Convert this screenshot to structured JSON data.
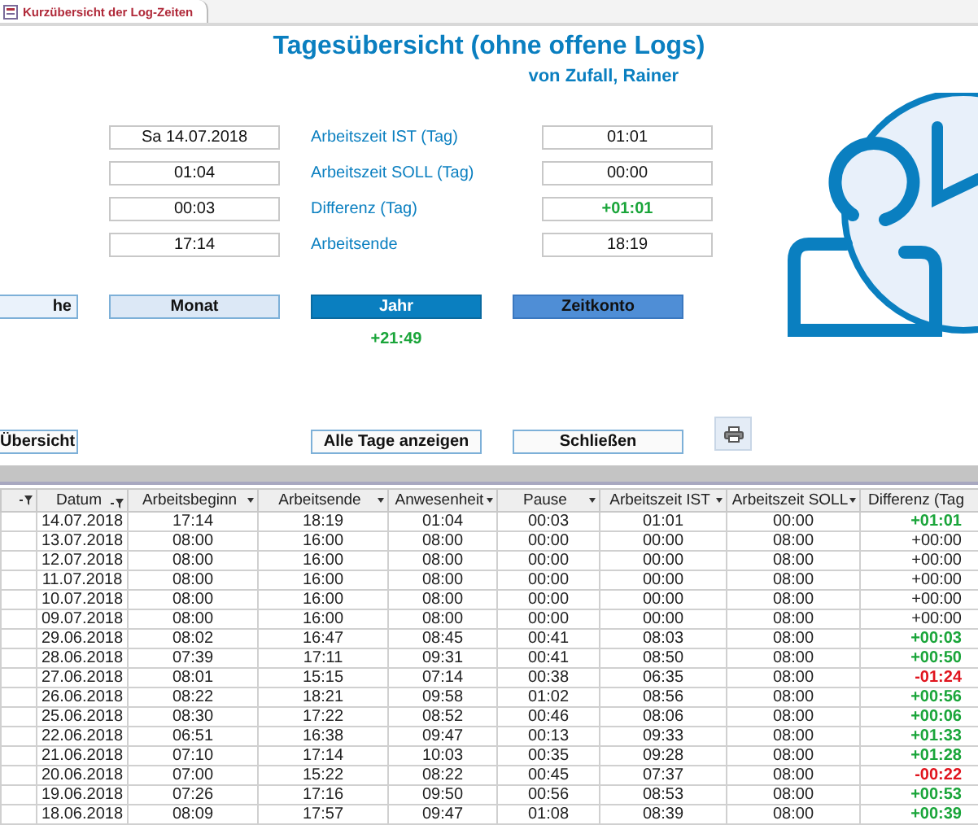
{
  "tab": {
    "title": "Kurzübersicht der Log-Zeiten"
  },
  "title": "Tagesübersicht (ohne offene Logs)",
  "subtitle": "von Zufall, Rainer",
  "fields": [
    {
      "value": "Sa 14.07.2018",
      "label": "Arbeitszeit IST (Tag)",
      "result": "01:01",
      "kind": "plain"
    },
    {
      "value": "01:04",
      "label": "Arbeitszeit SOLL (Tag)",
      "result": "00:00",
      "kind": "plain"
    },
    {
      "value": "00:03",
      "label": "Differenz (Tag)",
      "result": "+01:01",
      "kind": "plus"
    },
    {
      "value": "17:14",
      "label": "Arbeitsende",
      "result": "18:19",
      "kind": "plain"
    }
  ],
  "period_buttons": [
    {
      "label": "he",
      "selected": false
    },
    {
      "label": "Monat",
      "selected": false
    },
    {
      "label": "Jahr",
      "selected": true
    }
  ],
  "account_button": {
    "label": "Zeitkonto"
  },
  "year_balance": "+21:49",
  "actions": [
    {
      "label": "Übersicht"
    },
    {
      "label": "Alle Tage anzeigen"
    },
    {
      "label": "Schließen"
    }
  ],
  "table": {
    "selector_column": {
      "filtered": true
    },
    "columns": [
      {
        "label": "Datum",
        "filtered": true
      },
      {
        "label": "Arbeitsbeginn",
        "filtered": false
      },
      {
        "label": "Arbeitsende",
        "filtered": false
      },
      {
        "label": "Anwesenheit",
        "filtered": false
      },
      {
        "label": "Pause",
        "filtered": false
      },
      {
        "label": "Arbeitszeit IST",
        "filtered": false
      },
      {
        "label": "Arbeitszeit SOLL",
        "filtered": false
      },
      {
        "label": "Differenz (Tag"
      }
    ],
    "rows": [
      {
        "cells": [
          "14.07.2018",
          "17:14",
          "18:19",
          "01:04",
          "00:03",
          "01:01",
          "00:00"
        ],
        "diff": "+01:01",
        "kind": "plus"
      },
      {
        "cells": [
          "13.07.2018",
          "08:00",
          "16:00",
          "08:00",
          "00:00",
          "00:00",
          "08:00"
        ],
        "diff": "+00:00",
        "kind": "zero"
      },
      {
        "cells": [
          "12.07.2018",
          "08:00",
          "16:00",
          "08:00",
          "00:00",
          "00:00",
          "08:00"
        ],
        "diff": "+00:00",
        "kind": "zero"
      },
      {
        "cells": [
          "11.07.2018",
          "08:00",
          "16:00",
          "08:00",
          "00:00",
          "00:00",
          "08:00"
        ],
        "diff": "+00:00",
        "kind": "zero"
      },
      {
        "cells": [
          "10.07.2018",
          "08:00",
          "16:00",
          "08:00",
          "00:00",
          "00:00",
          "08:00"
        ],
        "diff": "+00:00",
        "kind": "zero"
      },
      {
        "cells": [
          "09.07.2018",
          "08:00",
          "16:00",
          "08:00",
          "00:00",
          "00:00",
          "08:00"
        ],
        "diff": "+00:00",
        "kind": "zero"
      },
      {
        "cells": [
          "29.06.2018",
          "08:02",
          "16:47",
          "08:45",
          "00:41",
          "08:03",
          "08:00"
        ],
        "diff": "+00:03",
        "kind": "plus"
      },
      {
        "cells": [
          "28.06.2018",
          "07:39",
          "17:11",
          "09:31",
          "00:41",
          "08:50",
          "08:00"
        ],
        "diff": "+00:50",
        "kind": "plus"
      },
      {
        "cells": [
          "27.06.2018",
          "08:01",
          "15:15",
          "07:14",
          "00:38",
          "06:35",
          "08:00"
        ],
        "diff": "-01:24",
        "kind": "minus"
      },
      {
        "cells": [
          "26.06.2018",
          "08:22",
          "18:21",
          "09:58",
          "01:02",
          "08:56",
          "08:00"
        ],
        "diff": "+00:56",
        "kind": "plus"
      },
      {
        "cells": [
          "25.06.2018",
          "08:30",
          "17:22",
          "08:52",
          "00:46",
          "08:06",
          "08:00"
        ],
        "diff": "+00:06",
        "kind": "plus"
      },
      {
        "cells": [
          "22.06.2018",
          "06:51",
          "16:38",
          "09:47",
          "00:13",
          "09:33",
          "08:00"
        ],
        "diff": "+01:33",
        "kind": "plus"
      },
      {
        "cells": [
          "21.06.2018",
          "07:10",
          "17:14",
          "10:03",
          "00:35",
          "09:28",
          "08:00"
        ],
        "diff": "+01:28",
        "kind": "plus"
      },
      {
        "cells": [
          "20.06.2018",
          "07:00",
          "15:22",
          "08:22",
          "00:45",
          "07:37",
          "08:00"
        ],
        "diff": "-00:22",
        "kind": "minus"
      },
      {
        "cells": [
          "19.06.2018",
          "07:26",
          "17:16",
          "09:50",
          "00:56",
          "08:53",
          "08:00"
        ],
        "diff": "+00:53",
        "kind": "plus"
      },
      {
        "cells": [
          "18.06.2018",
          "08:09",
          "17:57",
          "09:47",
          "01:08",
          "08:39",
          "08:00"
        ],
        "diff": "+00:39",
        "kind": "plus"
      }
    ]
  }
}
